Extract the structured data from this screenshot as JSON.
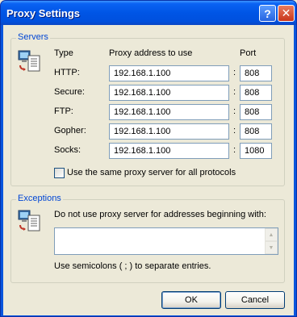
{
  "window": {
    "title": "Proxy Settings",
    "help_label": "?",
    "close_label": "✕"
  },
  "servers": {
    "group_label": "Servers",
    "col_type": "Type",
    "col_address": "Proxy address to use",
    "col_port": "Port",
    "rows": [
      {
        "type": "HTTP:",
        "address": "192.168.1.100",
        "port": "808"
      },
      {
        "type": "Secure:",
        "address": "192.168.1.100",
        "port": "808"
      },
      {
        "type": "FTP:",
        "address": "192.168.1.100",
        "port": "808"
      },
      {
        "type": "Gopher:",
        "address": "192.168.1.100",
        "port": "808"
      },
      {
        "type": "Socks:",
        "address": "192.168.1.100",
        "port": "1080"
      }
    ],
    "separator": ":",
    "same_proxy_label": "Use the same proxy server for all protocols",
    "same_proxy_checked": false
  },
  "exceptions": {
    "group_label": "Exceptions",
    "prompt": "Do not use proxy server for addresses beginning with:",
    "value": "",
    "hint": "Use semicolons ( ; ) to separate entries."
  },
  "buttons": {
    "ok": "OK",
    "cancel": "Cancel"
  }
}
